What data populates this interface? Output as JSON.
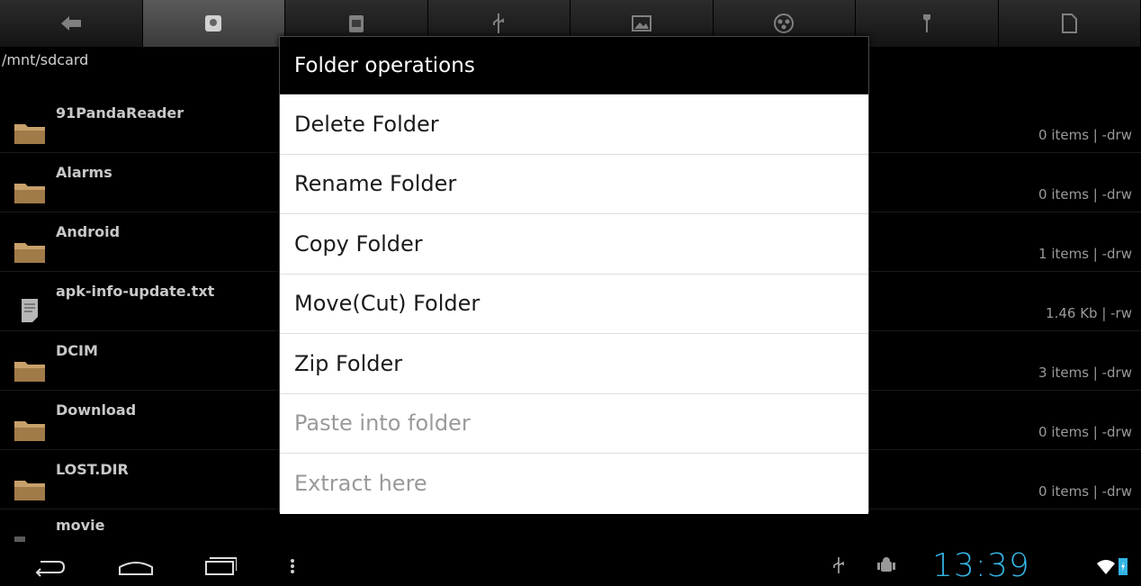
{
  "toolbar": {
    "buttons": [
      {
        "icon": "back-arrow-icon"
      },
      {
        "icon": "sdcard-icon",
        "active": true
      },
      {
        "icon": "sd-icon"
      },
      {
        "icon": "usb-icon"
      },
      {
        "icon": "image-icon"
      },
      {
        "icon": "video-icon"
      },
      {
        "icon": "tools-icon"
      },
      {
        "icon": "document-icon"
      }
    ]
  },
  "path": "/mnt/sdcard",
  "files": [
    {
      "name": "91PandaReader",
      "meta": "0 items | -drw",
      "type": "folder"
    },
    {
      "name": "Alarms",
      "meta": "0 items | -drw",
      "type": "folder"
    },
    {
      "name": "Android",
      "meta": "1 items | -drw",
      "type": "folder"
    },
    {
      "name": "apk-info-update.txt",
      "meta": "1.46 Kb  | -rw",
      "type": "file"
    },
    {
      "name": "DCIM",
      "meta": "3 items | -drw",
      "type": "folder"
    },
    {
      "name": "Download",
      "meta": "0 items | -drw",
      "type": "folder"
    },
    {
      "name": "LOST.DIR",
      "meta": "0 items | -drw",
      "type": "folder"
    },
    {
      "name": "movie",
      "meta": "",
      "type": "folder"
    }
  ],
  "dialog": {
    "title": "Folder operations",
    "items": [
      {
        "label": "Delete Folder",
        "enabled": true
      },
      {
        "label": "Rename Folder",
        "enabled": true
      },
      {
        "label": "Copy Folder",
        "enabled": true
      },
      {
        "label": "Move(Cut) Folder",
        "enabled": true
      },
      {
        "label": "Zip Folder",
        "enabled": true
      },
      {
        "label": "Paste into folder",
        "enabled": false
      },
      {
        "label": "Extract here",
        "enabled": false
      }
    ]
  },
  "statusbar": {
    "time": "13:39",
    "accent_color": "#33b5e5",
    "icons": [
      "usb-icon",
      "android-debug-icon",
      "wifi-icon",
      "battery-icon"
    ]
  },
  "colors": {
    "folder": "#c8a06a",
    "dialog_bg": "#ffffff",
    "disabled_text": "#9a9a9a"
  }
}
